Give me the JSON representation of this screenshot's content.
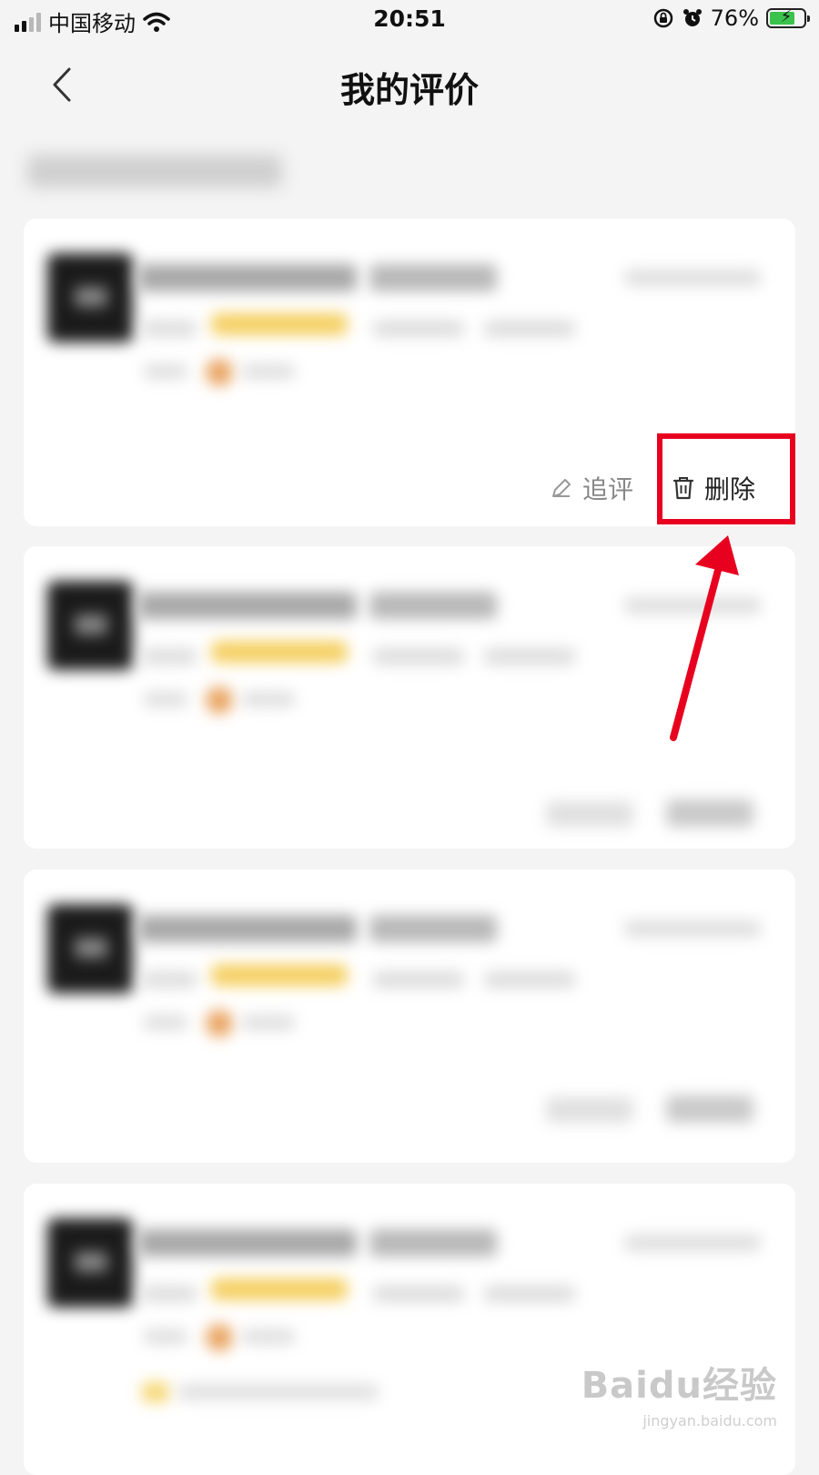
{
  "status_bar": {
    "carrier": "中国移动",
    "time": "20:51",
    "battery_percent": "76%",
    "battery_level": 0.76,
    "battery_color": "#3ac24c"
  },
  "nav": {
    "title": "我的评价",
    "back_icon": "chevron-left-icon"
  },
  "review_cards": [
    {
      "follow_label": "追评",
      "delete_label": "删除",
      "content_blurred": true
    },
    {
      "content_blurred": true
    },
    {
      "content_blurred": true
    },
    {
      "content_blurred": true
    }
  ],
  "actions": {
    "follow_icon": "pencil-icon",
    "delete_icon": "trash-icon"
  },
  "annotation": {
    "color": "#e8001f"
  },
  "watermark": {
    "logo": "Baidu经验",
    "url": "jingyan.baidu.com"
  }
}
